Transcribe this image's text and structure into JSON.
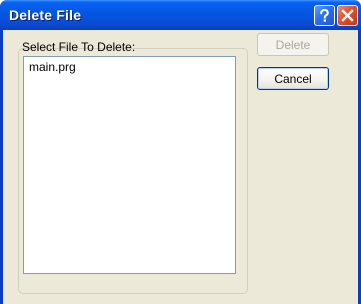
{
  "window": {
    "title": "Delete File",
    "help_icon": "question-mark-icon",
    "close_icon": "close-x-icon"
  },
  "group": {
    "label": "Select File To Delete:"
  },
  "files": [
    {
      "name": "main.prg"
    }
  ],
  "buttons": {
    "delete_label": "Delete",
    "delete_enabled": false,
    "cancel_label": "Cancel"
  },
  "colors": {
    "titlebar": "#0a5ae8",
    "face": "#ece9d8",
    "disabled_text": "#aca899",
    "close_button": "#e0502a"
  }
}
